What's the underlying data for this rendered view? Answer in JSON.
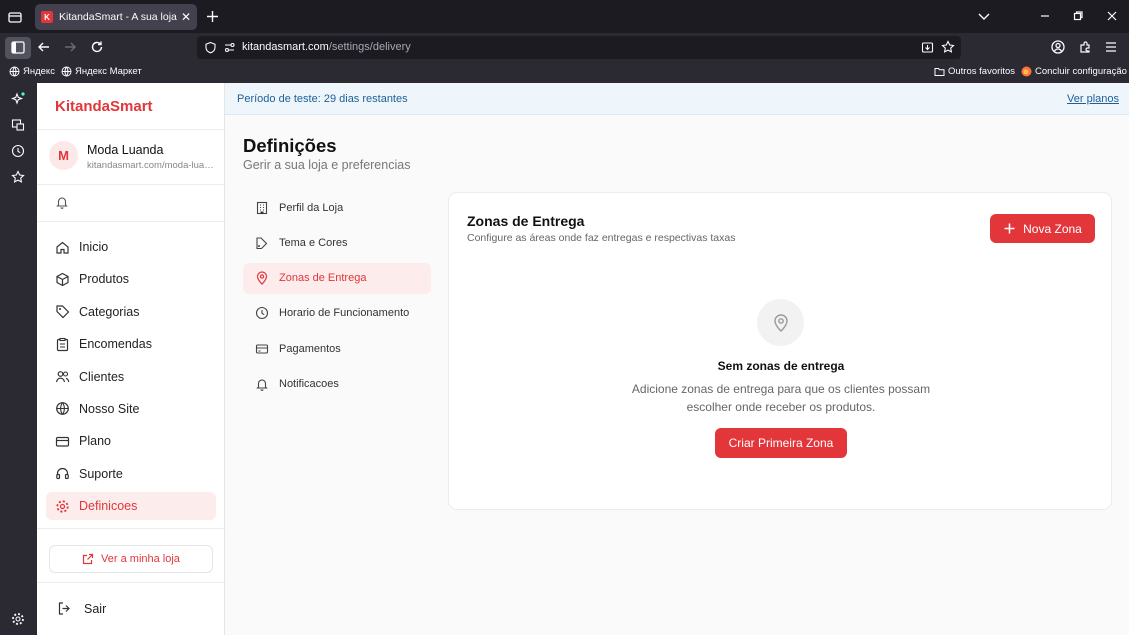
{
  "browser": {
    "tab_title": "KitandaSmart - A sua loja online",
    "favicon_letter": "K",
    "url_domain": "kitandasmart.com",
    "url_path": "/settings/delivery",
    "bookmarks": [
      "Яндекс",
      "Яндекс Маркет"
    ],
    "bookmarks_right": [
      "Outros favoritos",
      "Concluir configuração"
    ]
  },
  "sidebar": {
    "brand": "KitandaSmart",
    "store": {
      "initial": "M",
      "name": "Moda Luanda",
      "url": "kitandasmart.com/moda-luanda"
    },
    "items": [
      {
        "label": "Inicio",
        "icon": "home-icon"
      },
      {
        "label": "Produtos",
        "icon": "box-icon"
      },
      {
        "label": "Categorias",
        "icon": "tag-icon"
      },
      {
        "label": "Encomendas",
        "icon": "clipboard-icon"
      },
      {
        "label": "Clientes",
        "icon": "users-icon"
      },
      {
        "label": "Nosso Site",
        "icon": "globe-icon"
      },
      {
        "label": "Plano",
        "icon": "card-icon"
      },
      {
        "label": "Suporte",
        "icon": "headset-icon"
      },
      {
        "label": "Definicoes",
        "icon": "gear-icon",
        "active": true
      }
    ],
    "view_store": "Ver a minha loja",
    "logout": "Sair"
  },
  "trial": {
    "text": "Período de teste: 29 dias restantes",
    "link": "Ver planos"
  },
  "page": {
    "title": "Definições",
    "subtitle": "Gerir a sua loja e preferencias"
  },
  "settings_nav": [
    {
      "label": "Perfil da Loja",
      "icon": "building-icon"
    },
    {
      "label": "Tema e Cores",
      "icon": "palette-icon"
    },
    {
      "label": "Zonas de Entrega",
      "icon": "map-pin-icon",
      "active": true
    },
    {
      "label": "Horario de Funcionamento",
      "icon": "clock-icon"
    },
    {
      "label": "Pagamentos",
      "icon": "credit-card-icon"
    },
    {
      "label": "Notificacoes",
      "icon": "bell-icon"
    }
  ],
  "delivery": {
    "title": "Zonas de Entrega",
    "subtitle": "Configure as áreas onde faz entregas e respectivas taxas",
    "new_zone": "Nova Zona",
    "empty_title": "Sem zonas de entrega",
    "empty_desc": "Adicione zonas de entrega para que os clientes possam escolher onde receber os produtos.",
    "first_zone": "Criar Primeira Zona"
  },
  "colors": {
    "accent": "#e2363b",
    "active_bg": "#fdecec",
    "trial_bg": "#eef6fc",
    "trial_text": "#1f5e97"
  }
}
